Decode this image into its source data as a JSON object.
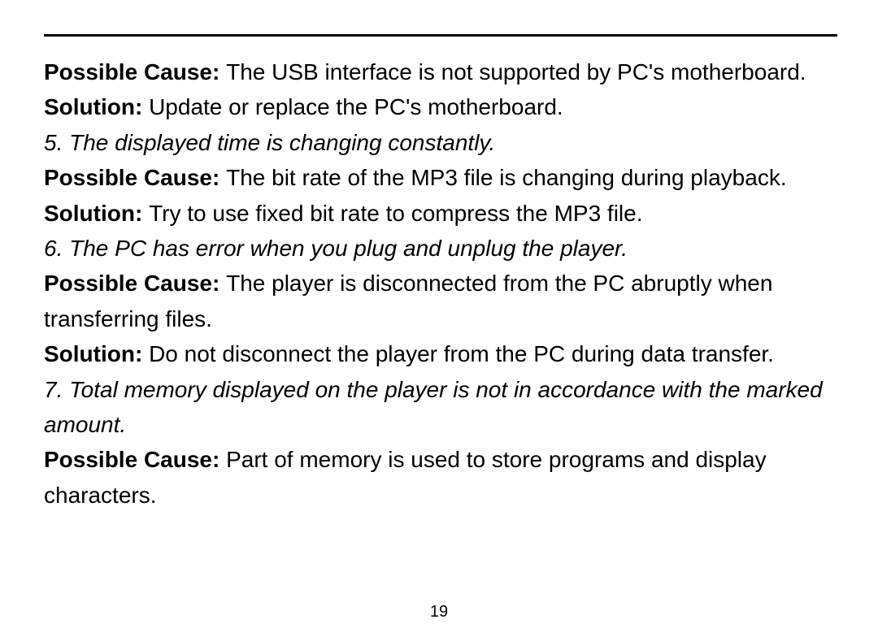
{
  "page_number": "19",
  "labels": {
    "possible_cause": "Possible Cause: ",
    "solution": "Solution: "
  },
  "item4": {
    "cause_text": "The USB interface is not supported by PC's motherboard.",
    "solution_text": "Update or replace the PC's motherboard."
  },
  "item5": {
    "heading": "5. The displayed time is changing constantly.",
    "cause_text": "The bit rate of the MP3 file is changing during playback.",
    "solution_text": "Try to use fixed bit rate to compress the MP3 file."
  },
  "item6": {
    "heading": "6. The PC has error when you plug and unplug the player.",
    "cause_text": "The player is disconnected from the PC abruptly when transferring files.",
    "solution_text": "Do not disconnect the player from the PC during data transfer."
  },
  "item7": {
    "heading": "7. Total memory displayed on the player is not in accordance with the marked amount.",
    "cause_text": "Part of memory is used to store programs and display characters."
  }
}
